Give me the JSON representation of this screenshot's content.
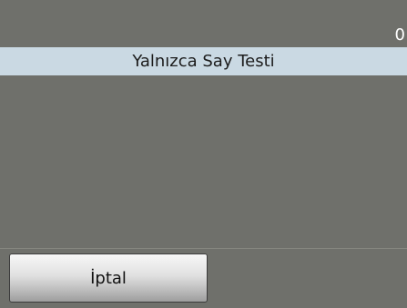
{
  "status": {
    "counter": "0"
  },
  "header": {
    "title": "Yalnızca Say Testi"
  },
  "footer": {
    "cancel_label": "İptal"
  }
}
